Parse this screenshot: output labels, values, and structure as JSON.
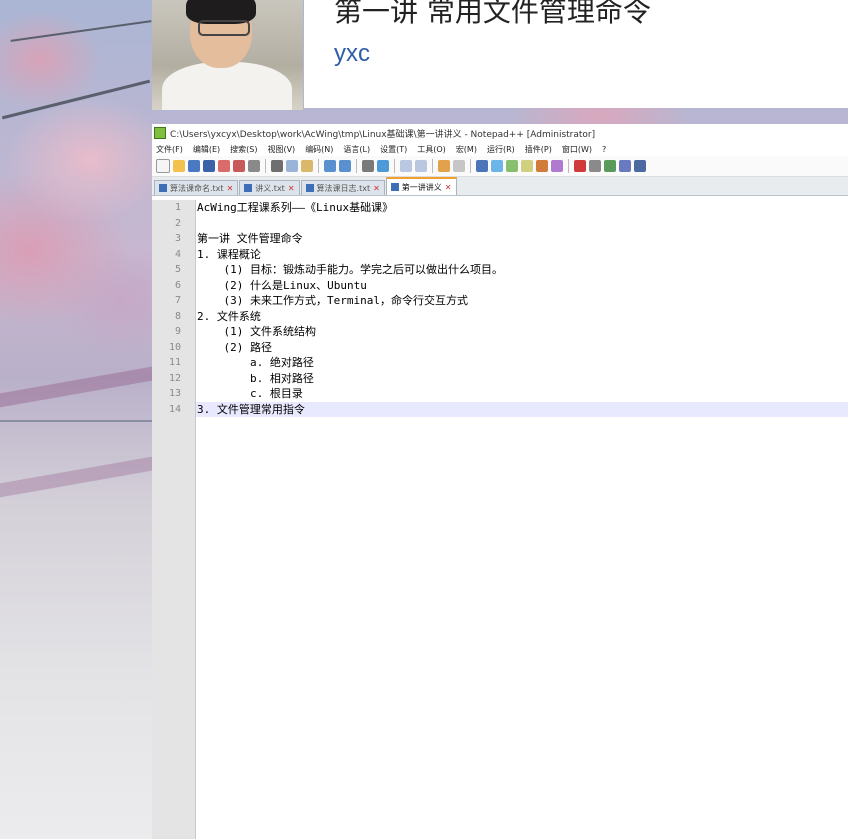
{
  "header": {
    "lecture_title": "第一讲 常用文件管理命令",
    "lecturer": "yxc"
  },
  "window": {
    "title": "C:\\Users\\yxcyx\\Desktop\\work\\AcWing\\tmp\\Linux基础课\\第一讲讲义 - Notepad++ [Administrator]"
  },
  "menu": [
    "文件(F)",
    "编辑(E)",
    "搜索(S)",
    "视图(V)",
    "编码(N)",
    "语言(L)",
    "设置(T)",
    "工具(O)",
    "宏(M)",
    "运行(R)",
    "插件(P)",
    "窗口(W)",
    "?"
  ],
  "tabs": [
    {
      "label": "算法课命名.txt"
    },
    {
      "label": "讲义.txt"
    },
    {
      "label": "算法课日志.txt"
    },
    {
      "label": "第一讲讲义",
      "active": true
    }
  ],
  "editor": {
    "current_line": 14,
    "lines": [
      "AcWing工程课系列——《Linux基础课》",
      "",
      "第一讲 文件管理命令",
      "1. 课程概论",
      "    (1) 目标：锻炼动手能力。学完之后可以做出什么项目。",
      "    (2) 什么是Linux、Ubuntu",
      "    (3) 未来工作方式，Terminal，命令行交互方式",
      "2. 文件系统",
      "    (1) 文件系统结构",
      "    (2) 路径",
      "        a. 绝对路径",
      "        b. 相对路径",
      "        c. 根目录",
      "3. 文件管理常用指令"
    ],
    "line_numbers": [
      "1",
      "2",
      "3",
      "4",
      "5",
      "6",
      "7",
      "8",
      "9",
      "10",
      "11",
      "12",
      "13",
      "14"
    ]
  },
  "colors": {
    "accent_tab": "#f0a030",
    "lecturer_text": "#2f5ea8",
    "current_line": "#e8e8ff"
  }
}
